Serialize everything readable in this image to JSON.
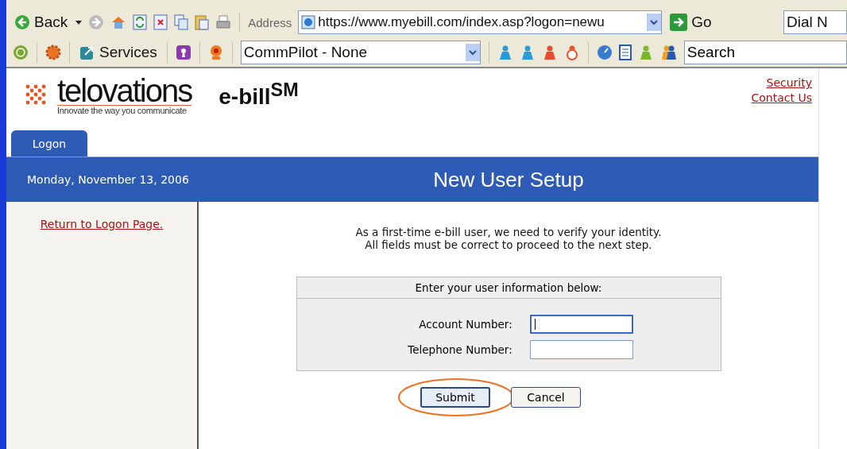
{
  "browser": {
    "back": "Back",
    "address_label": "Address",
    "url": "https://www.myebill.com/index.asp?logon=newu",
    "go": "Go",
    "dial": "Dial N",
    "services": "Services",
    "dropdown": "CommPilot - None",
    "search": "Search"
  },
  "header": {
    "brand": "telovations",
    "tagline": "Innovate the way you communicate",
    "product": "e-bill$^{SM}$",
    "links": [
      "Security",
      "Contact Us"
    ]
  },
  "tabs": [
    {
      "label": "Logon",
      "selected": true
    }
  ],
  "band": {
    "date": "Monday, November 13, 2006",
    "title": "New User Setup"
  },
  "sidebar": {
    "link": "Return to Logon Page."
  },
  "intro": [
    "As a first-time e-bill user, we need to verify your identity.",
    "All fields must be correct to proceed to the next step."
  ],
  "form": {
    "heading": "Enter your user information below:",
    "fields": [
      {
        "label": "Account Number:",
        "focused": true
      },
      {
        "label": "Telephone Number:",
        "focused": false
      }
    ]
  },
  "buttons": [
    {
      "label": "Submit",
      "highlighted": true
    },
    {
      "label": "Cancel",
      "highlighted": false
    }
  ]
}
